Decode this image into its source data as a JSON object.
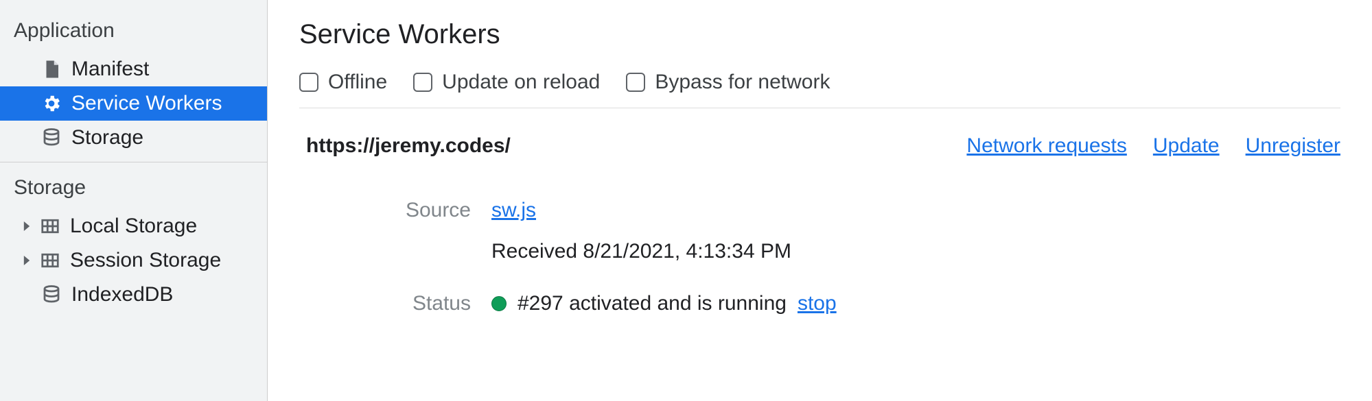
{
  "sidebar": {
    "section1_title": "Application",
    "items1": [
      {
        "label": "Manifest"
      },
      {
        "label": "Service Workers"
      },
      {
        "label": "Storage"
      }
    ],
    "section2_title": "Storage",
    "items2": [
      {
        "label": "Local Storage"
      },
      {
        "label": "Session Storage"
      },
      {
        "label": "IndexedDB"
      }
    ]
  },
  "main": {
    "title": "Service Workers",
    "opt_offline": "Offline",
    "opt_update": "Update on reload",
    "opt_bypass": "Bypass for network",
    "origin": "https://jeremy.codes/",
    "action_network": "Network requests",
    "action_update": "Update",
    "action_unregister": "Unregister",
    "label_source": "Source",
    "source_file": "sw.js",
    "received_text": "Received 8/21/2021, 4:13:34 PM",
    "label_status": "Status",
    "status_text": "#297 activated and is running",
    "status_stop": "stop"
  }
}
